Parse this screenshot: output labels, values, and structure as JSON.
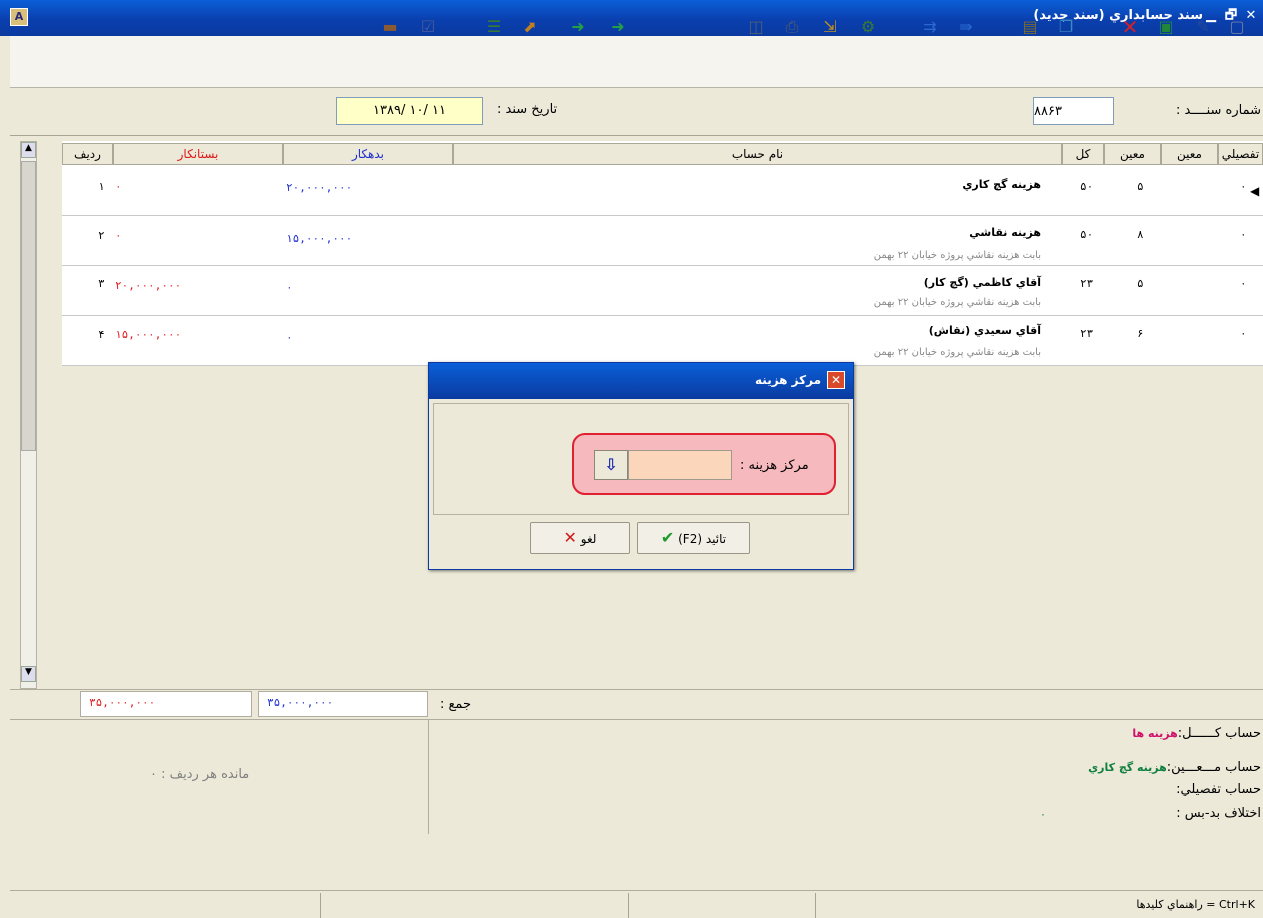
{
  "window": {
    "title": "سند حسابداري (سند جديد)",
    "close_glyph": "✕",
    "restore_glyph": "🗗",
    "min_glyph": "▁"
  },
  "toolbar": {
    "icons": [
      "new-doc-icon",
      "edit-pencil-icon",
      "save-icon",
      "delete-icon",
      "copy-icon",
      "paste-icon",
      "insert-row-icon",
      "delete-row-icon",
      "calculator-icon",
      "export-icon",
      "print-icon",
      "preview-icon",
      "next-icon",
      "prev-icon",
      "open-icon",
      "list-icon",
      "check-icon",
      "briefcase-icon"
    ]
  },
  "header": {
    "doc_no_label": "شماره سنــــد :",
    "doc_no_value": "۸۸۶۳",
    "date_label": "تاريخ سند :",
    "date_value": "۱۳۸۹/ ۱۰/ ۱۱"
  },
  "grid": {
    "columns": {
      "tafsili": "تفصيلي",
      "moein": "معين",
      "kol": "کل",
      "name": "نام حساب",
      "bedehkar": "بدهکار",
      "bestankar": "بستانکار",
      "radif": "رديف"
    },
    "rows": [
      {
        "tafsili": "۰",
        "moein": "۵",
        "kol": "۵۰",
        "name": "هزينه گچ کاري",
        "desc": "",
        "bedehkar": "۲۰,۰۰۰,۰۰۰",
        "bestankar": "۰",
        "radif": "۱"
      },
      {
        "tafsili": "۰",
        "moein": "۸",
        "kol": "۵۰",
        "name": "هزينه نقاشي",
        "desc": "بابت هزينه نقاشي پروژه خيابان ۲۲ بهمن",
        "bedehkar": "۱۵,۰۰۰,۰۰۰",
        "bestankar": "۰",
        "radif": "۲"
      },
      {
        "tafsili": "۰",
        "moein": "۵",
        "kol": "۲۳",
        "name": "آقاي کاظمي (گچ کار)",
        "desc": "بابت هزينه نقاشي پروژه خيابان ۲۲ بهمن",
        "bedehkar": "۰",
        "bestankar": "۲۰,۰۰۰,۰۰۰",
        "radif": "۳"
      },
      {
        "tafsili": "۰",
        "moein": "۶",
        "kol": "۲۳",
        "name": "آقاي سعيدي (نقاش)",
        "desc": "بابت هزينه نقاشي پروژه خيابان ۲۲ بهمن",
        "bedehkar": "۰",
        "bestankar": "۱۵,۰۰۰,۰۰۰",
        "radif": "۴"
      }
    ]
  },
  "totals": {
    "label": "جمع :",
    "bedehkar": "۳۵,۰۰۰,۰۰۰",
    "bestankar": "۳۵,۰۰۰,۰۰۰"
  },
  "info": {
    "kol_label": "حساب کــــــل:",
    "kol_value": "هزينه ها",
    "moein_label": "حساب مـــعـــين:",
    "moein_value": "هزينه گچ کاري",
    "tafsili_label": "حساب تفصيلي:",
    "ekhtelaf_label": "اختلاف بد-بس :",
    "ekhtelaf_value": "۰",
    "mande_label": "مانده هر رديف : ۰"
  },
  "status": {
    "hint": "راهنماي کليدها = Ctrl+K"
  },
  "dialog": {
    "title": "مرکز هزينه",
    "field_label": "مرکز هزينه :",
    "field_value": "",
    "ok_label": "تائيد (F2)",
    "cancel_label": "لغو"
  },
  "colors": {
    "debit": "#1c2ed0",
    "credit": "#e01a1a",
    "kol_value": "#d0106a",
    "moein_value": "#108040"
  }
}
